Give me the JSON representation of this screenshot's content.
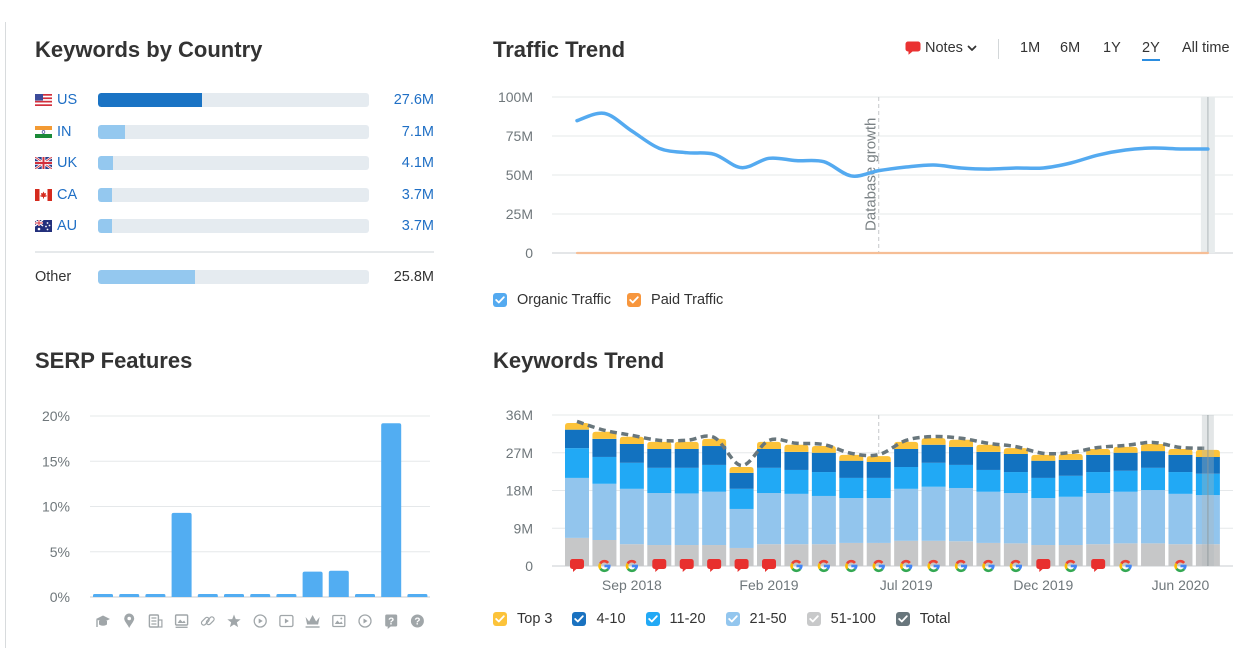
{
  "keywords_by_country": {
    "title": "Keywords by Country",
    "rows": [
      {
        "code": "US",
        "flag": "us-flag-icon",
        "value": "27.6M",
        "share": 0.383,
        "highlighted": true
      },
      {
        "code": "IN",
        "flag": "in-flag-icon",
        "value": "7.1M",
        "share": 0.099,
        "highlighted": false
      },
      {
        "code": "UK",
        "flag": "uk-flag-icon",
        "value": "4.1M",
        "share": 0.057,
        "highlighted": false
      },
      {
        "code": "CA",
        "flag": "ca-flag-icon",
        "value": "3.7M",
        "share": 0.051,
        "highlighted": false
      },
      {
        "code": "AU",
        "flag": "au-flag-icon",
        "value": "3.7M",
        "share": 0.051,
        "highlighted": false
      }
    ],
    "other": {
      "label": "Other",
      "value": "25.8M",
      "share": 0.358
    },
    "colors": {
      "highlighted_bar": "#1a73c4",
      "bar": "#94c8ef",
      "track": "#e5ebf0",
      "link": "#1f6fc5"
    }
  },
  "traffic_trend": {
    "title": "Traffic Trend",
    "notes": {
      "label": "Notes",
      "icon": "speech-bubble-icon",
      "dropdown_icon": "chevron-down-icon",
      "color": "#ea3232"
    },
    "ranges": [
      "1M",
      "6M",
      "1Y",
      "2Y",
      "All time"
    ],
    "active_range": "2Y",
    "legend": [
      {
        "label": "Organic Traffic",
        "checked": true,
        "color": "#54aaf0"
      },
      {
        "label": "Paid Traffic",
        "checked": true,
        "color": "#f7963d"
      }
    ]
  },
  "serp_features": {
    "title": "SERP Features"
  },
  "keywords_trend": {
    "title": "Keywords Trend",
    "legend": [
      {
        "label": "Top 3",
        "checked": true,
        "color": "#fcc33a"
      },
      {
        "label": "4-10",
        "checked": true,
        "color": "#1a72c0"
      },
      {
        "label": "11-20",
        "checked": true,
        "color": "#22a9f5"
      },
      {
        "label": "21-50",
        "checked": true,
        "color": "#93c6ee"
      },
      {
        "label": "51-100",
        "checked": true,
        "color": "#c8c9ca"
      },
      {
        "label": "Total",
        "checked": true,
        "color": "#68767c"
      }
    ]
  },
  "chart_data": [
    {
      "id": "traffic_trend",
      "type": "line",
      "title": "Traffic Trend",
      "xlabel": "",
      "ylabel": "",
      "ylim": [
        0,
        100
      ],
      "y_ticks": [
        0,
        25,
        50,
        75,
        100
      ],
      "y_tick_labels": [
        "0",
        "25M",
        "50M",
        "75M",
        "100M"
      ],
      "y_unit": "M",
      "grid": true,
      "legend": "bottom-left",
      "point_count": 24,
      "series": [
        {
          "name": "Organic Traffic",
          "color": "#54aaf0",
          "values": [
            84.8,
            89.5,
            78.2,
            67.1,
            64.3,
            63.3,
            54.7,
            60.7,
            59.2,
            58.5,
            49.4,
            52.8,
            55.1,
            56.4,
            54.5,
            53.8,
            54.5,
            54.5,
            57.7,
            62.8,
            66.0,
            67.3,
            66.7,
            66.7
          ]
        },
        {
          "name": "Paid Traffic",
          "color": "#f6be96",
          "values": [
            0,
            0,
            0,
            0,
            0,
            0,
            0,
            0,
            0,
            0,
            0,
            0,
            0,
            0,
            0,
            0,
            0,
            0,
            0,
            0,
            0,
            0,
            0,
            0
          ]
        }
      ],
      "annotations": [
        {
          "label": "Database growth",
          "index": 11
        }
      ],
      "highlight_index": 23
    },
    {
      "id": "serp_features",
      "type": "bar",
      "title": "SERP Features",
      "xlabel": "",
      "ylabel": "",
      "ylim": [
        0,
        20
      ],
      "y_ticks": [
        0,
        5,
        10,
        15,
        20
      ],
      "y_tick_labels": [
        "0%",
        "5%",
        "10%",
        "15%",
        "20%"
      ],
      "y_unit": "%",
      "grid": true,
      "color": "#52adf2",
      "categories": [
        "graduation-cap-icon",
        "location-pin-icon",
        "article-icon",
        "image-pack-icon",
        "link-icon",
        "star-icon",
        "play-circle-icon",
        "play-square-icon",
        "crown-icon",
        "picture-icon",
        "play-circle-icon",
        "question-square-icon",
        "question-circle-icon"
      ],
      "values": [
        0.3,
        0.3,
        0.3,
        9.3,
        0.3,
        0.3,
        0.3,
        0.3,
        2.8,
        2.9,
        0.3,
        19.2,
        0.3
      ]
    },
    {
      "id": "keywords_trend",
      "type": "bar",
      "stacked": true,
      "title": "Keywords Trend",
      "xlabel": "",
      "ylabel": "",
      "ylim": [
        0,
        36
      ],
      "y_ticks": [
        0,
        9,
        18,
        27,
        36
      ],
      "y_tick_labels": [
        "0",
        "9M",
        "18M",
        "27M",
        "36M"
      ],
      "y_unit": "M",
      "grid": true,
      "legend": "bottom-left",
      "x_ticks": [
        {
          "label": "Sep 2018",
          "index": 2
        },
        {
          "label": "Feb 2019",
          "index": 7
        },
        {
          "label": "Jul 2019",
          "index": 12
        },
        {
          "label": "Dec 2019",
          "index": 17
        },
        {
          "label": "Jun 2020",
          "index": 22
        }
      ],
      "series": [
        {
          "name": "51-100",
          "color": "#c6c7c8",
          "values": [
            6.7,
            6.2,
            5.2,
            5.0,
            5.0,
            5.0,
            4.3,
            5.2,
            5.2,
            5.2,
            5.5,
            5.5,
            6.0,
            6.0,
            5.9,
            5.5,
            5.4,
            5.0,
            5.0,
            5.2,
            5.4,
            5.4,
            5.2,
            5.2
          ]
        },
        {
          "name": "21-50",
          "color": "#92c5ed",
          "values": [
            14.3,
            13.4,
            13.2,
            12.4,
            12.3,
            12.7,
            9.3,
            12.2,
            12.0,
            11.5,
            10.7,
            10.7,
            12.4,
            12.9,
            12.7,
            12.2,
            12.0,
            11.2,
            11.5,
            12.2,
            12.3,
            12.7,
            12.0,
            11.7
          ]
        },
        {
          "name": "11-20",
          "color": "#21a9f5",
          "values": [
            7.1,
            6.4,
            6.2,
            6.0,
            6.1,
            6.4,
            4.8,
            6.0,
            5.7,
            5.7,
            4.8,
            4.8,
            5.2,
            5.7,
            5.5,
            5.2,
            5.0,
            4.8,
            5.0,
            5.0,
            5.0,
            5.3,
            5.2,
            5.1
          ]
        },
        {
          "name": "4-10",
          "color": "#1272c0",
          "values": [
            4.4,
            4.3,
            4.5,
            4.5,
            4.5,
            4.5,
            3.8,
            4.5,
            4.3,
            4.6,
            4.1,
            3.8,
            4.3,
            4.3,
            4.3,
            4.3,
            4.3,
            4.1,
            3.8,
            4.1,
            4.3,
            4.0,
            4.1,
            4.0
          ]
        },
        {
          "name": "Top 3",
          "color": "#fcc33a",
          "values": [
            1.6,
            1.7,
            1.7,
            1.7,
            1.7,
            1.7,
            1.4,
            1.7,
            1.7,
            1.6,
            1.4,
            1.4,
            1.7,
            1.6,
            1.7,
            1.7,
            1.4,
            1.4,
            1.4,
            1.4,
            1.4,
            1.7,
            1.4,
            1.7
          ]
        }
      ],
      "total": {
        "name": "Total",
        "color": "#68767c",
        "values": [
          34.1,
          32.0,
          30.8,
          29.6,
          29.6,
          30.3,
          23.6,
          29.6,
          28.9,
          28.6,
          26.5,
          26.2,
          29.6,
          30.5,
          30.1,
          28.9,
          28.1,
          26.5,
          26.7,
          27.9,
          28.4,
          29.1,
          27.9,
          27.7
        ]
      },
      "markers": [
        "note",
        "google",
        "google",
        "note",
        "note",
        "note",
        "note",
        "note",
        "google",
        "google",
        "google",
        "google",
        "google",
        "google",
        "google",
        "google",
        "google",
        "note",
        "google",
        "note",
        "google",
        null,
        "google",
        null
      ],
      "marker_icons": {
        "note": "note-marker-icon",
        "google": "google-update-icon"
      },
      "annotations": [
        {
          "index": 11
        }
      ],
      "highlight_index": 23
    }
  ]
}
